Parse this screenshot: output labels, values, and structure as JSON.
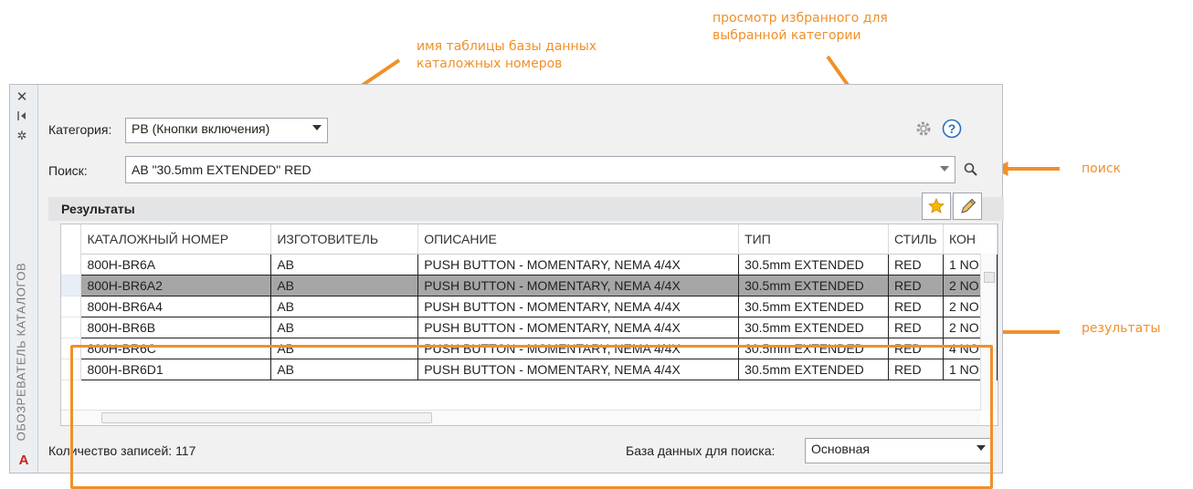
{
  "callouts": {
    "table_name": [
      "имя таблицы базы данных",
      "каталожных номеров"
    ],
    "favorites": [
      "просмотр избранного для",
      "выбранной категории"
    ],
    "search": "поиск",
    "results": "результаты"
  },
  "palette": {
    "vertical_title": "ОБОЗРЕВАТЕЛЬ КАТАЛОГОВ",
    "category_label": "Категория:",
    "category_value": "PB (Кнопки включения)",
    "search_label": "Поиск:",
    "search_value": "AB \"30.5mm EXTENDED\" RED",
    "results_title": "Результаты",
    "record_count": "Количество записей: 117",
    "search_db_label": "База данных для поиска:",
    "search_db_value": "Основная"
  },
  "table": {
    "columns": [
      "КАТАЛОЖНЫЙ НОМЕР",
      "ИЗГОТОВИТЕЛЬ",
      "ОПИСАНИЕ",
      "ТИП",
      "СТИЛЬ",
      "КОН"
    ],
    "rows": [
      [
        "800H-BR6A",
        "AB",
        "PUSH BUTTON - MOMENTARY, NEMA 4/4X",
        "30.5mm EXTENDED",
        "RED",
        "1 NO"
      ],
      [
        "800H-BR6A2",
        "AB",
        "PUSH BUTTON - MOMENTARY, NEMA 4/4X",
        "30.5mm EXTENDED",
        "RED",
        "2 NO"
      ],
      [
        "800H-BR6A4",
        "AB",
        "PUSH BUTTON - MOMENTARY, NEMA 4/4X",
        "30.5mm EXTENDED",
        "RED",
        "2 NO"
      ],
      [
        "800H-BR6B",
        "AB",
        "PUSH BUTTON - MOMENTARY, NEMA 4/4X",
        "30.5mm EXTENDED",
        "RED",
        "2 NO"
      ],
      [
        "800H-BR6C",
        "AB",
        "PUSH BUTTON - MOMENTARY, NEMA 4/4X",
        "30.5mm EXTENDED",
        "RED",
        "4 NO"
      ],
      [
        "800H-BR6D1",
        "AB",
        "PUSH BUTTON - MOMENTARY, NEMA 4/4X",
        "30.5mm EXTENDED",
        "RED",
        "1 NO"
      ]
    ],
    "selected_row": 1
  },
  "colors": {
    "accent": "#f0902a",
    "selection": "#a6a6a6",
    "star": "#f5b800",
    "help": "#2a6ebb",
    "logo": "#d01f1f"
  },
  "icons": [
    "close-icon",
    "auto-hide-icon",
    "properties-icon",
    "settings-gear-icon",
    "help-icon",
    "search-icon",
    "favorites-star-icon",
    "edit-pencil-icon",
    "autocad-logo"
  ]
}
